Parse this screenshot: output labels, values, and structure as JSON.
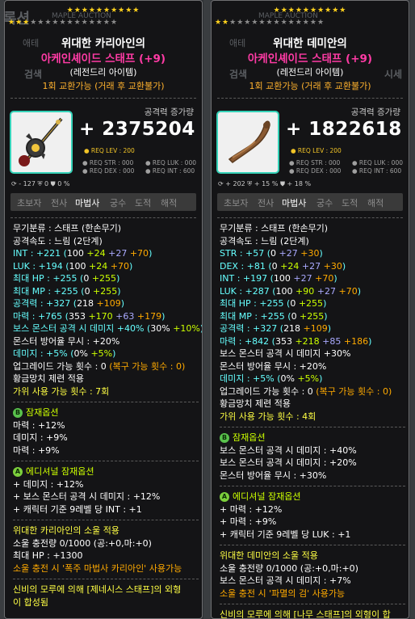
{
  "background": {
    "ghost_texts": [
      "록션",
      "MAPLE AUCTION",
      "애테",
      "검색",
      "시세",
      "세",
      "시세"
    ]
  },
  "left": {
    "stars_on": "★★★★★★★★★★",
    "stars_row2_on": "★★★",
    "stars_row2_off": "★★★★★★★★★★★★",
    "title1": "위대한 카리아인의",
    "title2": "아케인셰이드 스태프 (+9)",
    "grade": "(레전드리 아이템)",
    "trade": "1회 교환가능 (거래 후 교환불가)",
    "atk_caption": "공격력 증가량",
    "atk_value": "+ 2375204",
    "req_lev": "● REQ LEV : 200",
    "req": [
      "● REQ STR : 000",
      "● REQ LUK : 000",
      "● REQ DEX : 000",
      "● REQ INT : 600"
    ],
    "small_stats": "⟳ - 127   ⛨ 0   ⛊ 0 %",
    "jobs": [
      "초보자",
      "전사",
      "마법사",
      "궁수",
      "도적",
      "해적"
    ],
    "jobs_active": 2,
    "stats": [
      [
        [
          "무기분류 : 스태프 (한손무기)",
          "w"
        ]
      ],
      [
        [
          "공격속도 : 느림 (2단계)",
          "w"
        ]
      ],
      [
        [
          "INT : +221 (",
          "cy"
        ],
        [
          "100",
          "w"
        ],
        [
          " +24",
          "gr"
        ],
        [
          " +27",
          "pu"
        ],
        [
          " +70",
          "or"
        ],
        [
          ")",
          "cy"
        ]
      ],
      [
        [
          "LUK : +194 (",
          "cy"
        ],
        [
          "100",
          "w"
        ],
        [
          " +24",
          "gr"
        ],
        [
          " +70",
          "or"
        ],
        [
          ")",
          "cy"
        ]
      ],
      [
        [
          "최대 HP : +255 (",
          "cy"
        ],
        [
          "0",
          "w"
        ],
        [
          " +255",
          "gr"
        ],
        [
          ")",
          "cy"
        ]
      ],
      [
        [
          "최대 MP : +255 (",
          "cy"
        ],
        [
          "0",
          "w"
        ],
        [
          " +255",
          "gr"
        ],
        [
          ")",
          "cy"
        ]
      ],
      [
        [
          "공격력 : +327 (",
          "cy"
        ],
        [
          "218",
          "w"
        ],
        [
          " +109",
          "or"
        ],
        [
          ")",
          "cy"
        ]
      ],
      [
        [
          "마력 : +765 (",
          "cy"
        ],
        [
          "353",
          "w"
        ],
        [
          " +170",
          "gr"
        ],
        [
          " +63",
          "pu"
        ],
        [
          " +179",
          "or"
        ],
        [
          ")",
          "cy"
        ]
      ],
      [
        [
          "보스 몬스터 공격 시 데미지 +40% (",
          "cy"
        ],
        [
          "30%",
          "w"
        ],
        [
          " +10%",
          "gr"
        ],
        [
          ")",
          "cy"
        ]
      ],
      [
        [
          "몬스터 방어율 무시 : +20%",
          "w"
        ]
      ],
      [
        [
          "데미지 : +5% (",
          "cy"
        ],
        [
          "0%",
          "w"
        ],
        [
          " +5%",
          "gr"
        ],
        [
          ")",
          "cy"
        ]
      ],
      [
        [
          "업그레이드 가능 횟수 : 0 ",
          "w"
        ],
        [
          "(복구 가능 횟수 : 0)",
          "or"
        ]
      ],
      [
        [
          "황금망치 제련 적용",
          "w"
        ]
      ],
      [
        [
          "가위 사용 가능 횟수 : 7회",
          "ye"
        ]
      ]
    ],
    "potential": {
      "badge": "B",
      "title": "잠재옵션",
      "lines": [
        "마력 : +12%",
        "데미지 : +9%",
        "마력 : +9%"
      ]
    },
    "additional": {
      "badge": "A",
      "title": "에디셔널 잠재옵션",
      "lines": [
        "+ 데미지 : +12%",
        "+ 보스 몬스터 공격 시 데미지 : +12%",
        "+ 캐릭터 기준 9레벨 당 INT : +1"
      ]
    },
    "soul": {
      "title": "위대한 카리아인의 소울 적용",
      "charge": "소울 충전량 0/1000 (공:+0,마:+0)",
      "stat": "최대 HP : +1300",
      "skill": "소울 충전 시 '폭주 마법사 카리아인' 사용가능"
    },
    "mystic": [
      "신비의 모루에 의해 [제네시스 스태프]의 외형",
      "이 합성됨"
    ]
  },
  "right": {
    "stars_on": "★★★★★★★★★★",
    "stars_row2_on": "★★",
    "stars_row2_off": "★★★★★★★★★★★★★",
    "title1": "위대한 데미안의",
    "title2": "아케인셰이드 스태프 (+9)",
    "grade": "(레전드리 아이템)",
    "trade": "1회 교환가능 (거래 후 교환불가)",
    "atk_caption": "공격력 증가량",
    "atk_value": "+ 1822618",
    "req_lev": "● REQ LEV : 200",
    "req": [
      "● REQ STR : 000",
      "● REQ LUK : 000",
      "● REQ DEX : 000",
      "● REQ INT : 600"
    ],
    "small_stats": "⟳ + 202   ⛨ + 15 %   ⛊ + 18 %",
    "jobs": [
      "초보자",
      "전사",
      "마법사",
      "궁수",
      "도적",
      "해적"
    ],
    "jobs_active": 2,
    "stats": [
      [
        [
          "무기분류 : 스태프 (한손무기)",
          "w"
        ]
      ],
      [
        [
          "공격속도 : 느림 (2단계)",
          "w"
        ]
      ],
      [
        [
          "STR : +57 (",
          "cy"
        ],
        [
          "0",
          "w"
        ],
        [
          " +27",
          "pu"
        ],
        [
          " +30",
          "or"
        ],
        [
          ")",
          "cy"
        ]
      ],
      [
        [
          "DEX : +81 (",
          "cy"
        ],
        [
          "0",
          "w"
        ],
        [
          " +24",
          "gr"
        ],
        [
          " +27",
          "pu"
        ],
        [
          " +30",
          "or"
        ],
        [
          ")",
          "cy"
        ]
      ],
      [
        [
          "INT : +197 (",
          "cy"
        ],
        [
          "100",
          "w"
        ],
        [
          " +27",
          "pu"
        ],
        [
          " +70",
          "or"
        ],
        [
          ")",
          "cy"
        ]
      ],
      [
        [
          "LUK : +287 (",
          "cy"
        ],
        [
          "100",
          "w"
        ],
        [
          " +90",
          "gr"
        ],
        [
          " +27",
          "pu"
        ],
        [
          " +70",
          "or"
        ],
        [
          ")",
          "cy"
        ]
      ],
      [
        [
          "최대 HP : +255 (",
          "cy"
        ],
        [
          "0",
          "w"
        ],
        [
          " +255",
          "gr"
        ],
        [
          ")",
          "cy"
        ]
      ],
      [
        [
          "최대 MP : +255 (",
          "cy"
        ],
        [
          "0",
          "w"
        ],
        [
          " +255",
          "gr"
        ],
        [
          ")",
          "cy"
        ]
      ],
      [
        [
          "공격력 : +327 (",
          "cy"
        ],
        [
          "218",
          "w"
        ],
        [
          " +109",
          "or"
        ],
        [
          ")",
          "cy"
        ]
      ],
      [
        [
          "마력 : +842 (",
          "cy"
        ],
        [
          "353",
          "w"
        ],
        [
          " +218",
          "gr"
        ],
        [
          " +85",
          "pu"
        ],
        [
          " +186",
          "or"
        ],
        [
          ")",
          "cy"
        ]
      ],
      [
        [
          "보스 몬스터 공격 시 데미지 +30%",
          "w"
        ]
      ],
      [
        [
          "몬스터 방어율 무시 : +20%",
          "w"
        ]
      ],
      [
        [
          "데미지 : +5% (",
          "cy"
        ],
        [
          "0%",
          "w"
        ],
        [
          " +5%",
          "gr"
        ],
        [
          ")",
          "cy"
        ]
      ],
      [
        [
          "업그레이드 가능 횟수 : 0 ",
          "w"
        ],
        [
          "(복구 가능 횟수 : 0)",
          "or"
        ]
      ],
      [
        [
          "황금망치 제련 적용",
          "w"
        ]
      ],
      [
        [
          "가위 사용 가능 횟수 : 4회",
          "ye"
        ]
      ]
    ],
    "potential": {
      "badge": "B",
      "title": "잠재옵션",
      "lines": [
        "보스 몬스터 공격 시 데미지 : +40%",
        "보스 몬스터 공격 시 데미지 : +20%",
        "몬스터 방어율 무시 : +30%"
      ]
    },
    "additional": {
      "badge": "A",
      "title": "에디셔널 잠재옵션",
      "lines": [
        "+ 마력 : +12%",
        "+ 마력 : +9%",
        "+ 캐릭터 기준 9레벨 당 LUK : +1"
      ]
    },
    "soul": {
      "title": "위대한 데미안의 소울 적용",
      "charge": "소울 충전량 0/1000 (공:+0,마:+0)",
      "stat": "보스 몬스터 공격 시 데미지 : +7%",
      "skill": "소울 충전 시 '파멸의 검' 사용가능"
    },
    "mystic": [
      "신비의 모루에 의해 [나무 스태프]의 외형이 합"
    ]
  }
}
